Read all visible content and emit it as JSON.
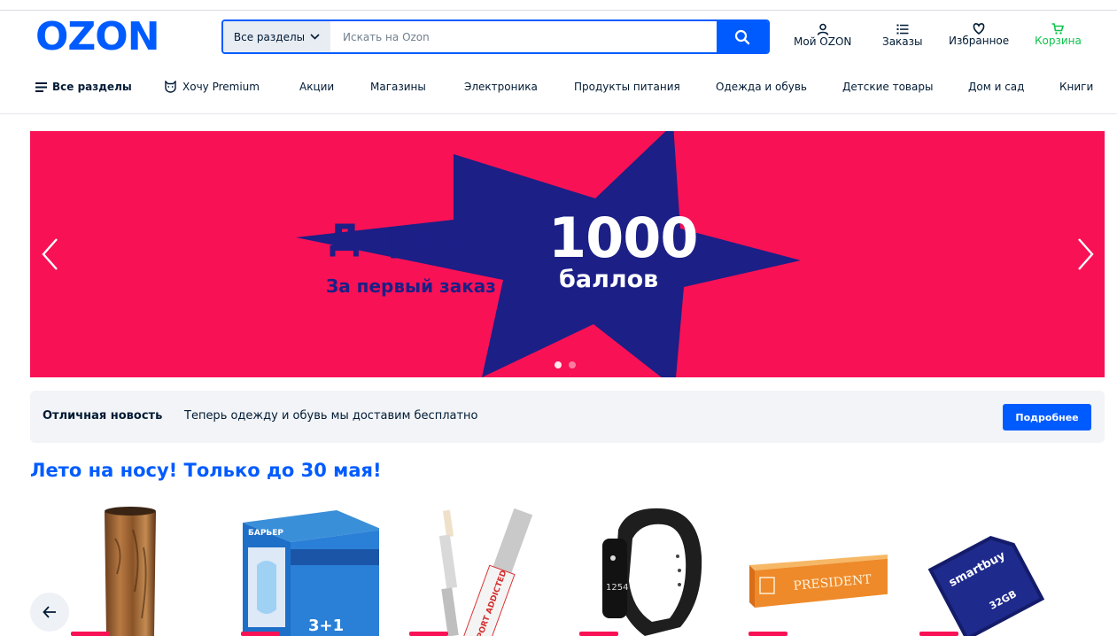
{
  "header": {
    "logo": "OZON",
    "search": {
      "category": "Все разделы",
      "placeholder": "Искать на Ozon"
    },
    "my_ozon": "Мой OZON",
    "orders": "Заказы",
    "favorites": "Избранное",
    "cart": "Корзина"
  },
  "nav": {
    "all": "Все разделы",
    "items": [
      "Хочу Premium",
      "Акции",
      "Магазины",
      "Электроника",
      "Продукты питания",
      "Одежда и обувь",
      "Детские товары",
      "Дом и сад",
      "Книги"
    ]
  },
  "banner": {
    "title": "Дарим",
    "subtitle": "За первый заказ",
    "number": "1000",
    "unit": "баллов",
    "colors": {
      "background": "#f91155",
      "star": "#1b1f86"
    }
  },
  "info": {
    "bold": "Отличная новость",
    "text": "Теперь одежду и обувь мы доставим бесплатно",
    "button": "Подробнее"
  },
  "section": {
    "title": "Лето на носу! Только до 30 мая!",
    "products": [
      {
        "icon": "wooden-knife-block-icon"
      },
      {
        "icon": "water-filter-box-icon",
        "box_text": "БАРЬЕР",
        "badge": "3+1"
      },
      {
        "icon": "concealer-tube-icon",
        "tube_text": "SPORT ADDICTED"
      },
      {
        "icon": "fitness-band-icon",
        "screen_text": "1254"
      },
      {
        "icon": "toothpaste-box-icon",
        "box_text": "PRESIDENT"
      },
      {
        "icon": "sd-card-icon",
        "card_brand": "smartbuy",
        "card_size": "32GB"
      }
    ]
  },
  "accent": "#005bff"
}
